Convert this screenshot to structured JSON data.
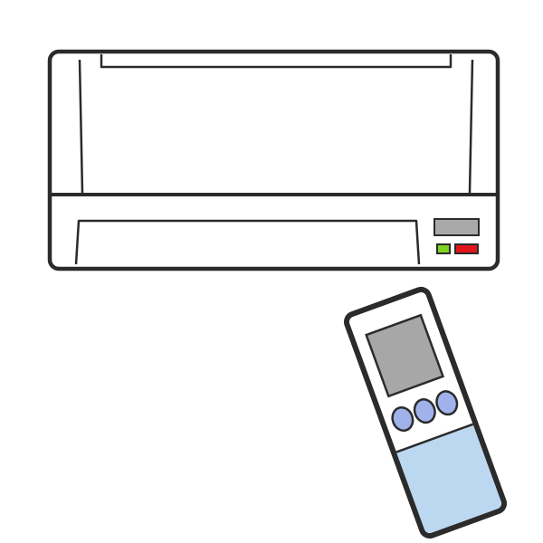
{
  "scene": {
    "subject": "air-conditioner-and-remote",
    "colors": {
      "background": "#ffffff",
      "outline": "#2b2b2b",
      "unit_body": "#ffffff",
      "display_gray": "#a9a9a9",
      "indicator_green": "#7ed321",
      "indicator_red": "#e0151d",
      "remote_screen": "#a7a7a7",
      "remote_buttons": "#9fb2ea",
      "remote_lower_panel": "#bcd8f1"
    },
    "air_conditioner": {
      "indicators": [
        {
          "name": "power-indicator",
          "color": "#7ed321"
        },
        {
          "name": "mode-indicator",
          "color": "#e0151d"
        }
      ]
    },
    "remote_control": {
      "button_count": 3
    }
  }
}
